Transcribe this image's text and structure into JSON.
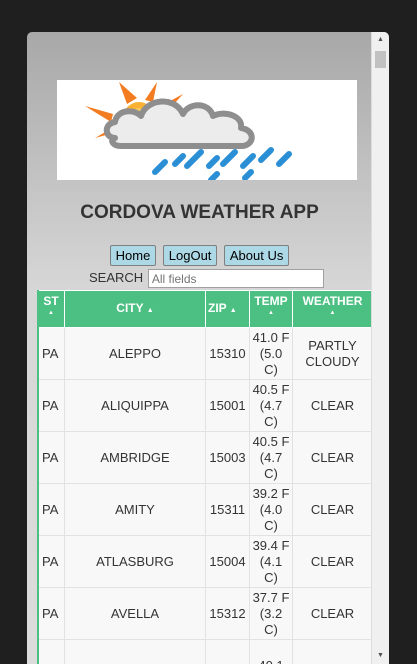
{
  "app": {
    "title": "CORDOVA WEATHER APP",
    "banner_icon": "sun-cloud-rain-icon"
  },
  "nav": {
    "home_label": "Home",
    "logout_label": "LogOut",
    "about_label": "About Us",
    "button_color": "#add8e6"
  },
  "search": {
    "label": "SEARCH",
    "placeholder": "All fields"
  },
  "table": {
    "header_color": "#4cc083",
    "headers": {
      "st": "ST",
      "city": "CITY",
      "zip": "ZIP",
      "temp": "TEMP",
      "weather": "WEATHER"
    },
    "rows": [
      {
        "st": "PA",
        "city": "ALEPPO",
        "zip": "15310",
        "temp": "41.0 F (5.0 C)",
        "weather": "PARTLY CLOUDY"
      },
      {
        "st": "PA",
        "city": "ALIQUIPPA",
        "zip": "15001",
        "temp": "40.5 F (4.7 C)",
        "weather": "CLEAR"
      },
      {
        "st": "PA",
        "city": "AMBRIDGE",
        "zip": "15003",
        "temp": "40.5 F (4.7 C)",
        "weather": "CLEAR"
      },
      {
        "st": "PA",
        "city": "AMITY",
        "zip": "15311",
        "temp": "39.2 F (4.0 C)",
        "weather": "CLEAR"
      },
      {
        "st": "PA",
        "city": "ATLASBURG",
        "zip": "15004",
        "temp": "39.4 F (4.1 C)",
        "weather": "CLEAR"
      },
      {
        "st": "PA",
        "city": "AVELLA",
        "zip": "15312",
        "temp": "37.7 F (3.2 C)",
        "weather": "CLEAR"
      },
      {
        "st": "",
        "city": "",
        "zip": "",
        "temp": "40.1",
        "weather": ""
      }
    ]
  }
}
